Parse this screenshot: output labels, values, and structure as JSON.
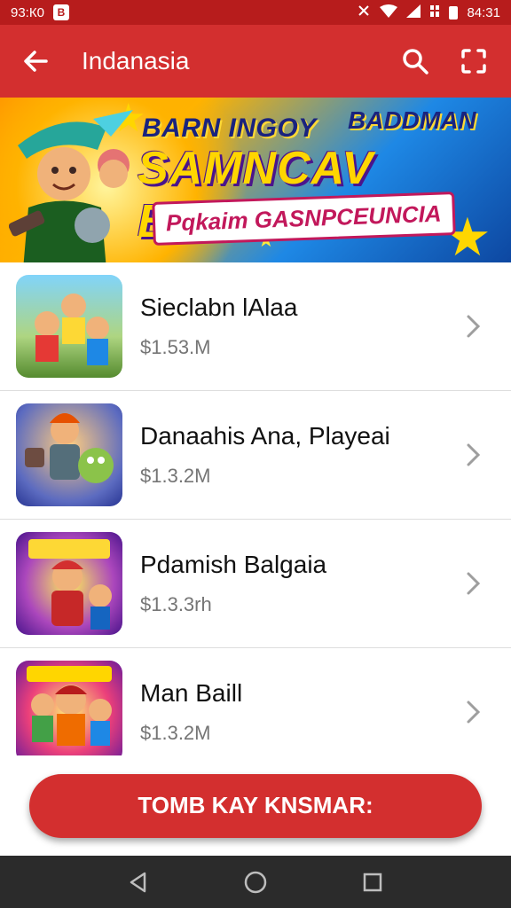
{
  "status_bar": {
    "time": "93:К0",
    "badge": "В",
    "right_time": "84:31",
    "icons": [
      "notification-icon",
      "wifi-icon",
      "signal-icon",
      "battery-icon"
    ]
  },
  "app_bar": {
    "title": "Indanasia",
    "back_icon": "arrow-left-icon",
    "search_icon": "search-icon",
    "fullscreen_icon": "expand-icon",
    "background": "#d32f2f"
  },
  "banner": {
    "line1": "BARN INGOY",
    "line1b": "BADDMAN",
    "line2": "SAMNCAV BILLK",
    "subtitle": "Pqkaim GASNPCEUNCIA"
  },
  "items": [
    {
      "title": "Sieclabn lAlaa",
      "price": "$1.53.M"
    },
    {
      "title": "Danaahis Ana, Playeai",
      "price": "$1.3.2M"
    },
    {
      "title": "Pdamish Balgaia",
      "price": "$1.3.3rh"
    },
    {
      "title": "Man Baill",
      "price": "$1.3.2M"
    }
  ],
  "cta": {
    "label": "TOMB KAY KNSMAR:",
    "color": "#d32f2f"
  },
  "nav_bar": {
    "icons": [
      "back-triangle-icon",
      "home-circle-icon",
      "recents-square-icon"
    ]
  }
}
